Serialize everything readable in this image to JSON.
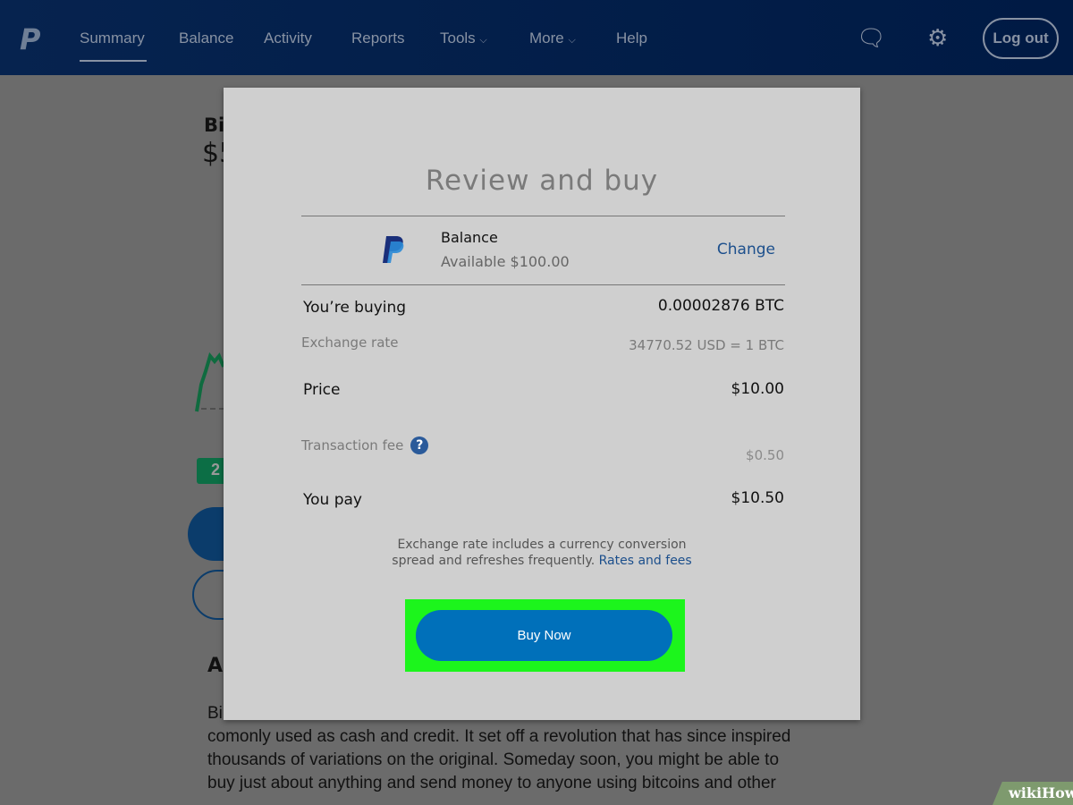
{
  "nav": {
    "items": [
      "Summary",
      "Balance",
      "Activity",
      "Reports",
      "Tools",
      "More",
      "Help"
    ],
    "logout": "Log out",
    "active": "Summary"
  },
  "background": {
    "heading_partial": "Bi",
    "price_partial": "$5",
    "badge_partial": "2",
    "section_partial": "A",
    "paragraph": [
      "Bi",
      "comonly used as cash and credit. It set off a revolution that has since inspired",
      "thousands of variations on the original. Someday soon, you might be able to",
      "buy just about anything and send money to anyone using bitcoins and other"
    ]
  },
  "modal": {
    "title": "Review and buy",
    "funding": {
      "name": "Balance",
      "available": "Available $100.00",
      "change": "Change"
    },
    "rows": {
      "buying_label": "You’re buying",
      "buying_value": "0.00002876 BTC",
      "rate_label": "Exchange rate",
      "rate_value": "34770.52 USD = 1 BTC",
      "price_label": "Price",
      "price_value": "$10.00",
      "fee_label": "Transaction fee",
      "fee_value": "$0.50",
      "pay_label": "You pay",
      "pay_value": "$10.50"
    },
    "disclaimer_line1": "Exchange rate includes a currency conversion",
    "disclaimer_line2": "spread and refreshes frequently.",
    "rates_link": "Rates and fees",
    "buy_button": "Buy Now",
    "help_icon": "?"
  },
  "colors": {
    "accent": "#0070ba",
    "highlight": "#1cf51c",
    "link": "#1c4f8c"
  },
  "watermark": "wikiHow"
}
